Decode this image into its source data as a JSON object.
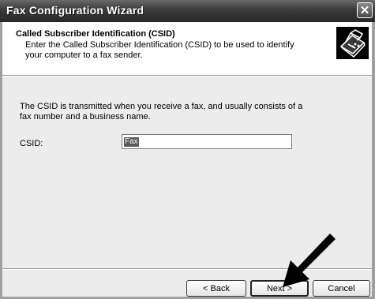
{
  "window": {
    "title": "Fax Configuration Wizard",
    "close_symbol": "✕"
  },
  "header": {
    "title": "Called Subscriber Identification (CSID)",
    "description": "Enter the Called Subscriber Identification (CSID) to be used to identify your computer to a fax sender.",
    "icon": "fax-machine-icon"
  },
  "body": {
    "info_text": "The CSID is transmitted when you receive a fax, and usually consists of a fax number and a business name.",
    "csid_label": "CSID:",
    "csid_value": "Fax"
  },
  "buttons": {
    "back": "< Back",
    "next": "Next >",
    "cancel": "Cancel"
  },
  "annotation": {
    "arrow": "pointer-arrow-icon",
    "color": "#000000"
  }
}
